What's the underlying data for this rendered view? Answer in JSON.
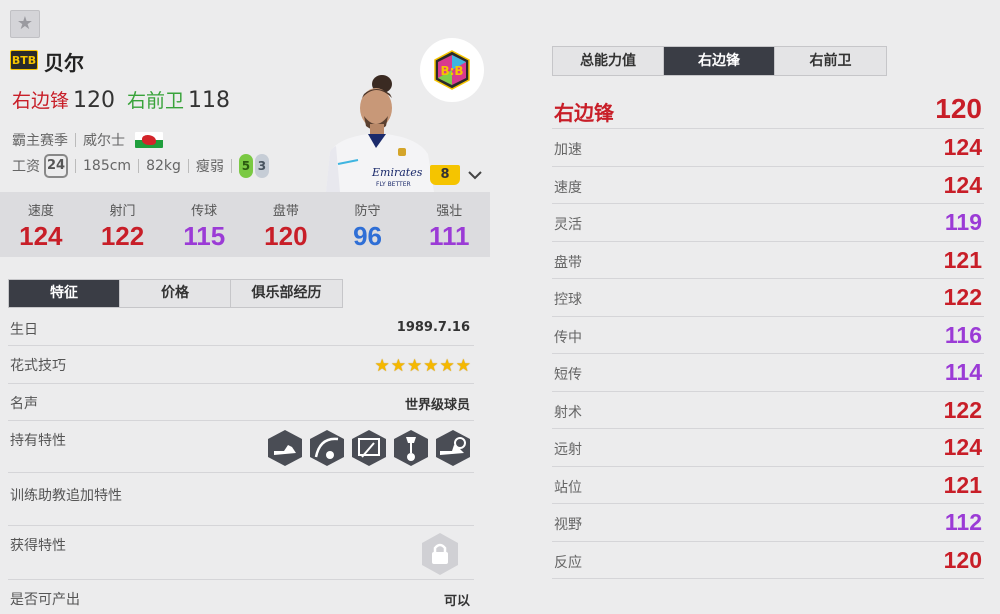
{
  "header": {
    "favorite_icon": "star-icon",
    "season_badge": "BTB",
    "player_name": "贝尔",
    "positions": [
      {
        "label": "右边锋",
        "value": "120",
        "color": "#c81e28"
      },
      {
        "label": "右前卫",
        "value": "118",
        "color": "#38a33a"
      }
    ],
    "season": "霸主赛季",
    "nationality": "威尔士",
    "flag_icon": "wales-flag-icon",
    "salary_label": "工资",
    "salary": "24",
    "height": "185cm",
    "weight": "82kg",
    "body_type": "瘦弱",
    "weak_foot": "5",
    "skill_level": "3",
    "club_icon": "club-logo-icon",
    "upgrade_level": "8",
    "expand_icon": "chevron-down-icon"
  },
  "stats": [
    {
      "label": "速度",
      "value": "124",
      "color": "#c81e28"
    },
    {
      "label": "射门",
      "value": "122",
      "color": "#c81e28"
    },
    {
      "label": "传球",
      "value": "115",
      "color": "#9b3bd6"
    },
    {
      "label": "盘带",
      "value": "120",
      "color": "#c81e28"
    },
    {
      "label": "防守",
      "value": "96",
      "color": "#2f6fd6"
    },
    {
      "label": "强壮",
      "value": "111",
      "color": "#9b3bd6"
    }
  ],
  "tabs": [
    "特征",
    "价格",
    "俱乐部经历"
  ],
  "info": {
    "birthday_label": "生日",
    "birthday": "1989.7.16",
    "skill_label": "花式技巧",
    "skill_stars": "★★★★★★",
    "fame_label": "名声",
    "fame": "世界级球员",
    "traits_label": "持有特性",
    "trait_icons": [
      "trait-boot-icon",
      "trait-curve-shot-icon",
      "trait-long-shot-icon",
      "trait-finesse-icon",
      "trait-speed-dribbler-icon"
    ],
    "coach_traits_label": "训练助教追加特性",
    "acquired_traits_label": "获得特性",
    "lock_icon": "lock-icon",
    "producible_label": "是否可产出",
    "producible": "可以"
  },
  "right": {
    "tabs": [
      "总能力值",
      "右边锋",
      "右前卫"
    ],
    "position_label": "右边锋",
    "position_value": "120",
    "attributes": [
      {
        "label": "加速",
        "value": "124",
        "color": "#c81e28"
      },
      {
        "label": "速度",
        "value": "124",
        "color": "#c81e28"
      },
      {
        "label": "灵活",
        "value": "119",
        "color": "#9b3bd6"
      },
      {
        "label": "盘带",
        "value": "121",
        "color": "#c81e28"
      },
      {
        "label": "控球",
        "value": "122",
        "color": "#c81e28"
      },
      {
        "label": "传中",
        "value": "116",
        "color": "#9b3bd6"
      },
      {
        "label": "短传",
        "value": "114",
        "color": "#9b3bd6"
      },
      {
        "label": "射术",
        "value": "122",
        "color": "#c81e28"
      },
      {
        "label": "远射",
        "value": "124",
        "color": "#c81e28"
      },
      {
        "label": "站位",
        "value": "121",
        "color": "#c81e28"
      },
      {
        "label": "视野",
        "value": "112",
        "color": "#9b3bd6"
      },
      {
        "label": "反应",
        "value": "120",
        "color": "#c81e28"
      }
    ]
  }
}
